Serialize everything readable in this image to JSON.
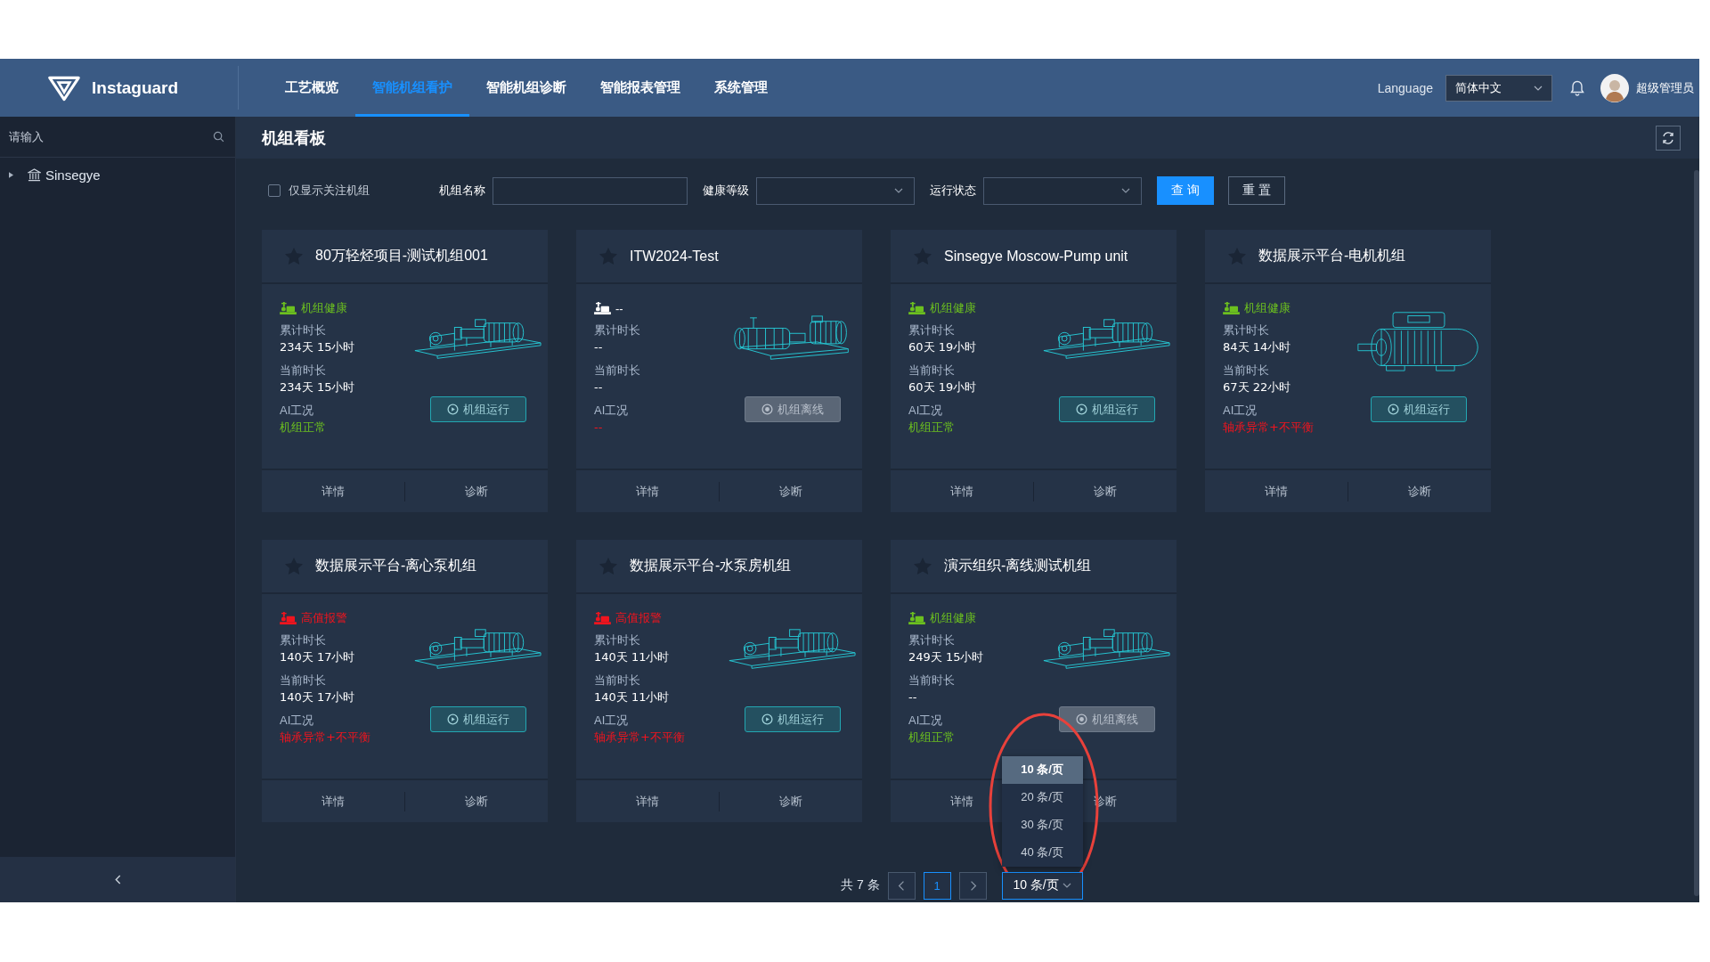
{
  "header": {
    "logo": "Instaguard",
    "nav": [
      {
        "label": "工艺概览",
        "selected": false
      },
      {
        "label": "智能机组看护",
        "selected": true
      },
      {
        "label": "智能机组诊断",
        "selected": false
      },
      {
        "label": "智能报表管理",
        "selected": false
      },
      {
        "label": "系统管理",
        "selected": false
      }
    ],
    "language_label": "Language",
    "language_select": "简体中文",
    "user": "超级管理员"
  },
  "sidebar": {
    "search": {
      "placeholder": "请输入"
    },
    "tree": [
      {
        "label": "Sinsegye",
        "expanded": false
      }
    ]
  },
  "page_title": "机组看板",
  "filters": {
    "follow_only": {
      "label": "仅显示关注机组",
      "checked": false
    },
    "fields": [
      {
        "label": "机组名称",
        "kind": "input"
      },
      {
        "label": "健康等级",
        "kind": "select"
      },
      {
        "label": "运行状态",
        "kind": "select"
      }
    ],
    "buttons": [
      {
        "label": "查 询",
        "kind": "primary"
      },
      {
        "label": "重 置",
        "kind": "default"
      }
    ]
  },
  "cards": [
    {
      "title": "80万轻烃项目-测试机组001",
      "starred": false,
      "health": {
        "text": "机组健康",
        "color": "#6cc01f"
      },
      "total_label": "累计时长",
      "total": "234天 15小时",
      "current_label": "当前时长",
      "current": "234天 15小时",
      "ai": {
        "label": "AI工况",
        "text": "机组正常",
        "color": "#6cc01f"
      },
      "online": true,
      "run_label": "机组运行",
      "kind": "pump",
      "actions": [
        "详情",
        "诊断"
      ]
    },
    {
      "title": "ITW2024-Test",
      "starred": false,
      "health": {
        "text": "--",
        "color": "#ffffff"
      },
      "total_label": "累计时长",
      "total": "--",
      "current_label": "当前时长",
      "current": "--",
      "ai": {
        "label": "AI工况",
        "text": "--",
        "color": "#f0141e"
      },
      "online": false,
      "run_label": "机组离线",
      "kind": "multistage",
      "actions": [
        "详情",
        "诊断"
      ]
    },
    {
      "title": "Sinsegye Moscow-Pump unit",
      "starred": false,
      "health": {
        "text": "机组健康",
        "color": "#6cc01f"
      },
      "total_label": "累计时长",
      "total": "60天 19小时",
      "current_label": "当前时长",
      "current": "60天 19小时",
      "ai": {
        "label": "AI工况",
        "text": "机组正常",
        "color": "#6cc01f"
      },
      "online": true,
      "run_label": "机组运行",
      "kind": "pump",
      "actions": [
        "详情",
        "诊断"
      ]
    },
    {
      "title": "数据展示平台-电机机组",
      "starred": false,
      "health": {
        "text": "机组健康",
        "color": "#6cc01f"
      },
      "total_label": "累计时长",
      "total": "84天 14小时",
      "current_label": "当前时长",
      "current": "67天 22小时",
      "ai": {
        "label": "AI工况",
        "text": "轴承异常+不平衡",
        "color": "#f0141e"
      },
      "online": true,
      "run_label": "机组运行",
      "kind": "motor",
      "actions": [
        "详情",
        "诊断"
      ]
    },
    {
      "title": "数据展示平台-离心泵机组",
      "starred": false,
      "health": {
        "text": "高值报警",
        "color": "#f0141e"
      },
      "total_label": "累计时长",
      "total": "140天 17小时",
      "current_label": "当前时长",
      "current": "140天 17小时",
      "ai": {
        "label": "AI工况",
        "text": "轴承异常+不平衡",
        "color": "#f0141e"
      },
      "online": true,
      "run_label": "机组运行",
      "kind": "pump",
      "actions": [
        "详情",
        "诊断"
      ]
    },
    {
      "title": "数据展示平台-水泵房机组",
      "starred": false,
      "health": {
        "text": "高值报警",
        "color": "#f0141e"
      },
      "total_label": "累计时长",
      "total": "140天 11小时",
      "current_label": "当前时长",
      "current": "140天 11小时",
      "ai": {
        "label": "AI工况",
        "text": "轴承异常+不平衡",
        "color": "#f0141e"
      },
      "online": true,
      "run_label": "机组运行",
      "kind": "pump",
      "actions": [
        "详情",
        "诊断"
      ]
    },
    {
      "title": "演示组织-离线测试机组",
      "starred": false,
      "health": {
        "text": "机组健康",
        "color": "#6cc01f"
      },
      "total_label": "累计时长",
      "total": "249天 15小时",
      "current_label": "当前时长",
      "current": "--",
      "ai": {
        "label": "AI工况",
        "text": "机组正常",
        "color": "#6cc01f"
      },
      "online": false,
      "run_label": "机组离线",
      "kind": "pump",
      "actions": [
        "详情",
        "诊断"
      ]
    }
  ],
  "pagination": {
    "total": "共 7 条",
    "pages": [
      {
        "label": "1",
        "selected": true
      }
    ],
    "page_size": "10 条/页",
    "options": [
      {
        "label": "10 条/页",
        "selected": true
      },
      {
        "label": "20 条/页",
        "selected": false
      },
      {
        "label": "30 条/页",
        "selected": false
      },
      {
        "label": "40 条/页",
        "selected": false
      }
    ]
  },
  "annotations": [
    {
      "kind": "ellipse"
    }
  ]
}
